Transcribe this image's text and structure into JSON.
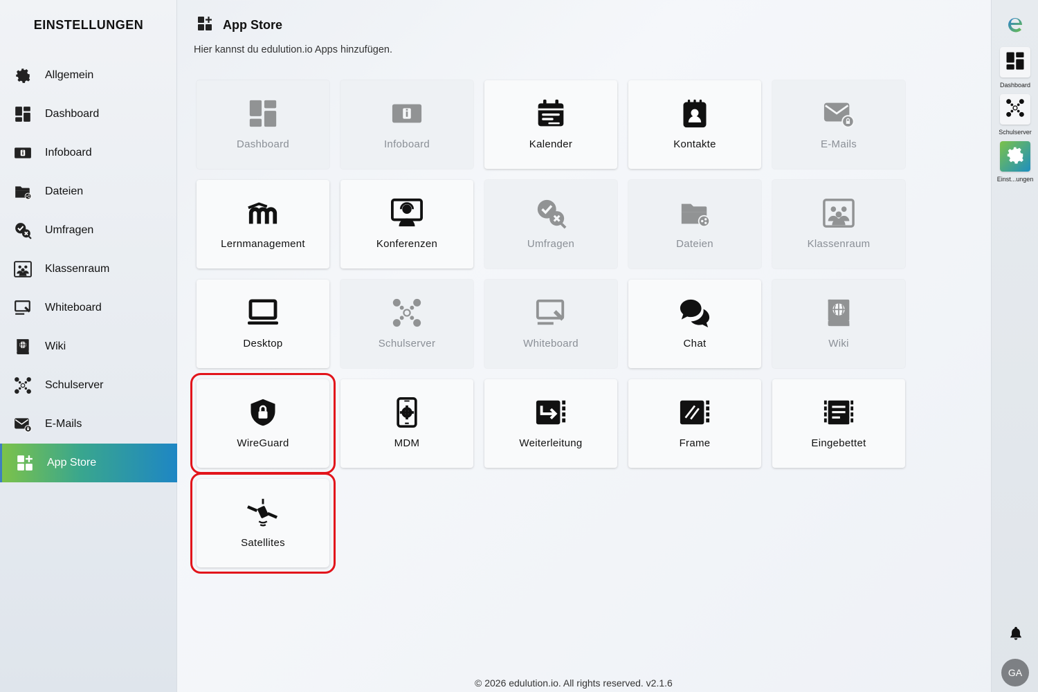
{
  "sidebar": {
    "title": "EINSTELLUNGEN",
    "items": [
      {
        "label": "Allgemein",
        "icon": "gear-icon"
      },
      {
        "label": "Dashboard",
        "icon": "dashboard-icon"
      },
      {
        "label": "Infoboard",
        "icon": "infoboard-icon"
      },
      {
        "label": "Dateien",
        "icon": "folder-share-icon"
      },
      {
        "label": "Umfragen",
        "icon": "survey-icon"
      },
      {
        "label": "Klassenraum",
        "icon": "classroom-icon"
      },
      {
        "label": "Whiteboard",
        "icon": "whiteboard-icon"
      },
      {
        "label": "Wiki",
        "icon": "wiki-icon"
      },
      {
        "label": "Schulserver",
        "icon": "network-icon"
      },
      {
        "label": "E-Mails",
        "icon": "mail-icon"
      },
      {
        "label": "App Store",
        "icon": "app-store-icon",
        "active": true
      }
    ]
  },
  "header": {
    "title": "App Store",
    "subtitle": "Hier kannst du edulution.io Apps hinzufügen."
  },
  "tiles": [
    {
      "label": "Dashboard",
      "icon": "dashboard-icon",
      "state": "inactive"
    },
    {
      "label": "Infoboard",
      "icon": "infoboard-icon",
      "state": "inactive"
    },
    {
      "label": "Kalender",
      "icon": "calendar-icon",
      "state": "active"
    },
    {
      "label": "Kontakte",
      "icon": "contacts-icon",
      "state": "active"
    },
    {
      "label": "E-Mails",
      "icon": "mail-icon",
      "state": "inactive"
    },
    {
      "label": "Lernmanagement",
      "icon": "moodle-icon",
      "state": "active"
    },
    {
      "label": "Konferenzen",
      "icon": "conference-icon",
      "state": "active"
    },
    {
      "label": "Umfragen",
      "icon": "survey-icon",
      "state": "inactive"
    },
    {
      "label": "Dateien",
      "icon": "folder-share-icon",
      "state": "inactive"
    },
    {
      "label": "Klassenraum",
      "icon": "classroom-icon",
      "state": "inactive"
    },
    {
      "label": "Desktop",
      "icon": "laptop-icon",
      "state": "active"
    },
    {
      "label": "Schulserver",
      "icon": "network-icon",
      "state": "inactive"
    },
    {
      "label": "Whiteboard",
      "icon": "whiteboard-icon",
      "state": "inactive"
    },
    {
      "label": "Chat",
      "icon": "chat-icon",
      "state": "active"
    },
    {
      "label": "Wiki",
      "icon": "wiki-icon",
      "state": "inactive"
    },
    {
      "label": "WireGuard",
      "icon": "shield-lock-icon",
      "state": "active",
      "highlighted": true
    },
    {
      "label": "MDM",
      "icon": "mobile-gear-icon",
      "state": "active"
    },
    {
      "label": "Weiterleitung",
      "icon": "forward-icon",
      "state": "active"
    },
    {
      "label": "Frame",
      "icon": "frame-icon",
      "state": "active"
    },
    {
      "label": "Eingebettet",
      "icon": "embedded-icon",
      "state": "active"
    },
    {
      "label": "Satellites",
      "icon": "satellite-icon",
      "state": "active",
      "highlighted": true
    }
  ],
  "footer": {
    "text": "© 2026 edulution.io. All rights reserved. v2.1.6"
  },
  "rail": {
    "logo": "edulution-logo-icon",
    "items": [
      {
        "label": "Dashboard",
        "icon": "dashboard-icon"
      },
      {
        "label": "Schulserver",
        "icon": "network-icon"
      },
      {
        "label": "Einst...ungen",
        "icon": "gear-icon",
        "active": true
      }
    ],
    "avatar": "GA"
  },
  "colors": {
    "highlight": "#e2141b",
    "accent_start": "#7cc24a",
    "accent_end": "#1e86c4"
  }
}
